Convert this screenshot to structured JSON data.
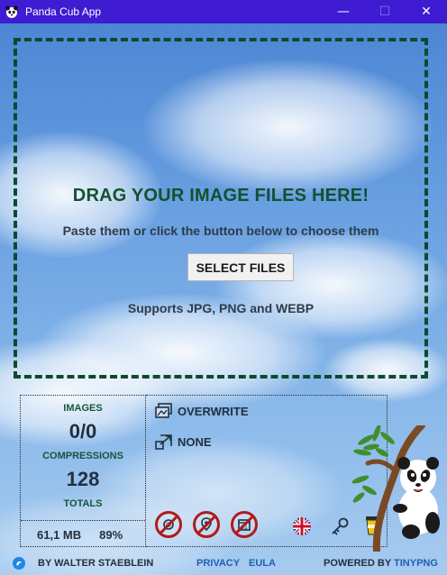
{
  "window": {
    "title": "Panda Cub App",
    "minimize": "—",
    "maximize": "☐",
    "close": "✕"
  },
  "dropzone": {
    "title": "DRAG YOUR IMAGE FILES HERE!",
    "subtitle": "Paste them or click the button below to choose them",
    "button": "SELECT FILES",
    "support": "Supports JPG, PNG and WEBP"
  },
  "stats": {
    "images_label": "IMAGES",
    "images_value": "0/0",
    "compressions_label": "COMPRESSIONS",
    "compressions_value": "128",
    "totals_label": "TOTALS",
    "total_size": "61,1 MB",
    "total_pct": "89%"
  },
  "options": {
    "overwrite": "OVERWRITE",
    "resize": "NONE"
  },
  "footer": {
    "author": "BY WALTER STAEBLEIN",
    "privacy": "PRIVACY",
    "eula": "EULA",
    "powered": "POWERED BY ",
    "tinypng": "TINYPNG"
  },
  "colors": {
    "titlebar": "#3f1bd1",
    "accent_green": "#14502f",
    "link_blue": "#1f5fb3",
    "disabled_red": "#b01a1a"
  }
}
